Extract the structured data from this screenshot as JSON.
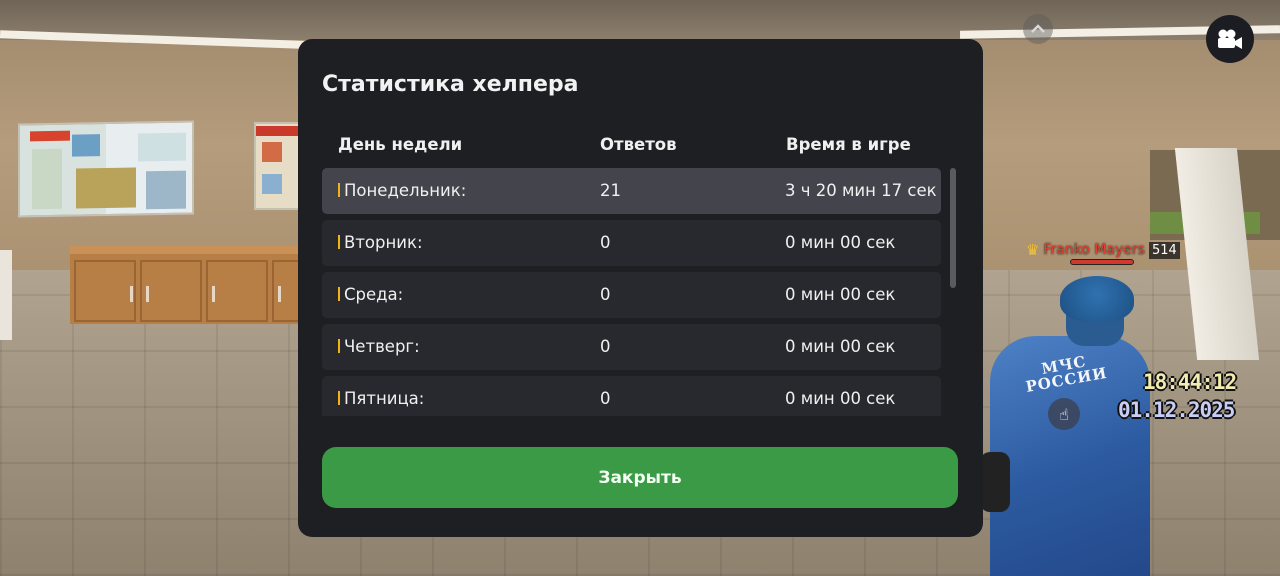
{
  "modal": {
    "title": "Статистика хелпера",
    "columns": {
      "day": "День недели",
      "answers": "Ответов",
      "time": "Время в игре"
    },
    "rows": [
      {
        "day": "Понедельник:",
        "answers": "21",
        "time": "3 ч 20 мин 17 сек",
        "active": true
      },
      {
        "day": "Вторник:",
        "answers": "0",
        "time": "0 мин 00 сек"
      },
      {
        "day": "Среда:",
        "answers": "0",
        "time": "0 мин 00 сек"
      },
      {
        "day": "Четверг:",
        "answers": "0",
        "time": "0 мин 00 сек"
      },
      {
        "day": "Пятница:",
        "answers": "0",
        "time": "0 мин 00 сек"
      }
    ],
    "close_label": "Закрыть",
    "colors": {
      "panel": "#1e1f23",
      "row": "#28292e",
      "row_active": "#44454c",
      "marker": "#f2b21c",
      "close_button": "#3b9a45"
    }
  },
  "hud": {
    "player_name": "Franko Mayers",
    "player_id": "514",
    "time": "18:44:12",
    "date": "01.12.2025",
    "icons": [
      "chevron-up-icon",
      "video-camera-icon",
      "crown-icon",
      "hand-touch-icon"
    ]
  },
  "scene": {
    "uniform_text": "МЧС\nРОССИИ",
    "poster_texts": [
      "НЕЛЬЗЯ",
      "STOP",
      "БЕЗОПАСНАЯ ЭВАКУАЦИЯ",
      "ПАМЯТКА ПО"
    ]
  }
}
